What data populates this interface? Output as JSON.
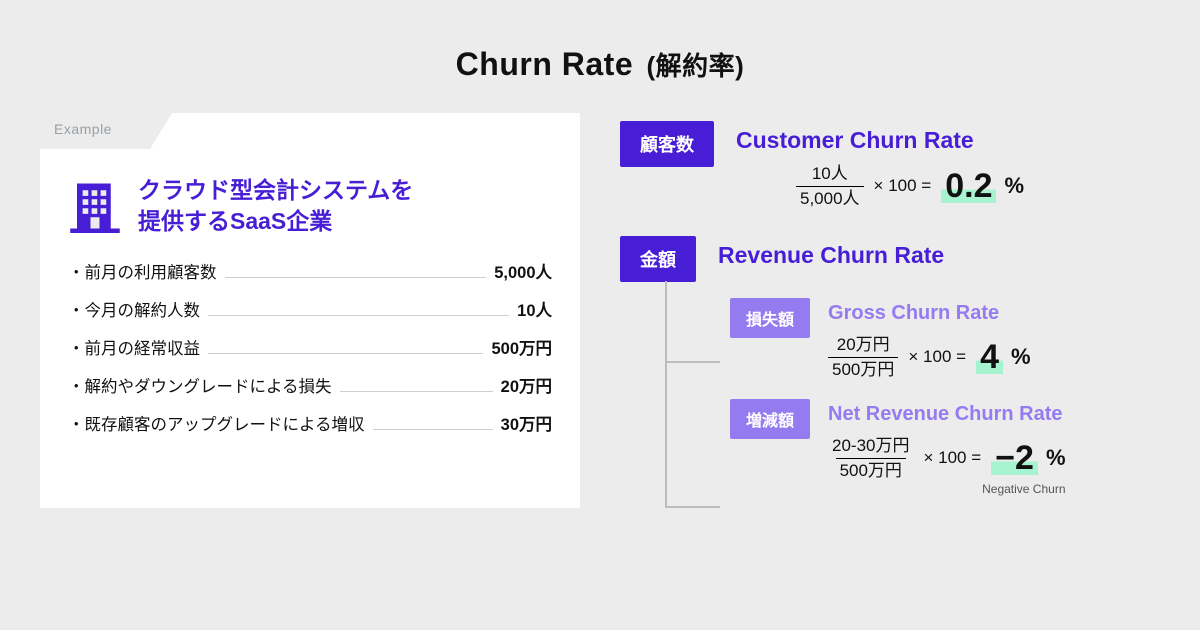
{
  "title_main": "Churn Rate",
  "title_sub": "(解約率)",
  "example": {
    "tab": "Example",
    "company_line1": "クラウド型会計システムを",
    "company_line2": "提供するSaaS企業",
    "rows": [
      {
        "label": "・前月の利用顧客数",
        "value": "5,000人"
      },
      {
        "label": "・今月の解約人数",
        "value": "10人"
      },
      {
        "label": "・前月の経常収益",
        "value": "500万円"
      },
      {
        "label": "・解約やダウングレードによる損失",
        "value": "20万円"
      },
      {
        "label": "・既存顧客のアップグレードによる増収",
        "value": "30万円"
      }
    ]
  },
  "customer": {
    "tag": "顧客数",
    "heading": "Customer Churn Rate",
    "numerator": "10人",
    "denominator": "5,000人",
    "times": "× 100 =",
    "result": "0.2",
    "result_suffix": "%"
  },
  "revenue": {
    "tag": "金額",
    "heading": "Revenue Churn Rate",
    "gross": {
      "tag": "損失額",
      "heading": "Gross Churn Rate",
      "numerator": "20万円",
      "denominator": "500万円",
      "times": "× 100 =",
      "result": "4",
      "result_suffix": "%"
    },
    "net": {
      "tag": "増減額",
      "heading": "Net Revenue Churn Rate",
      "numerator": "20-30万円",
      "denominator": "500万円",
      "times": "× 100 =",
      "result": "−2",
      "result_suffix": "%",
      "note": "Negative Churn"
    }
  }
}
